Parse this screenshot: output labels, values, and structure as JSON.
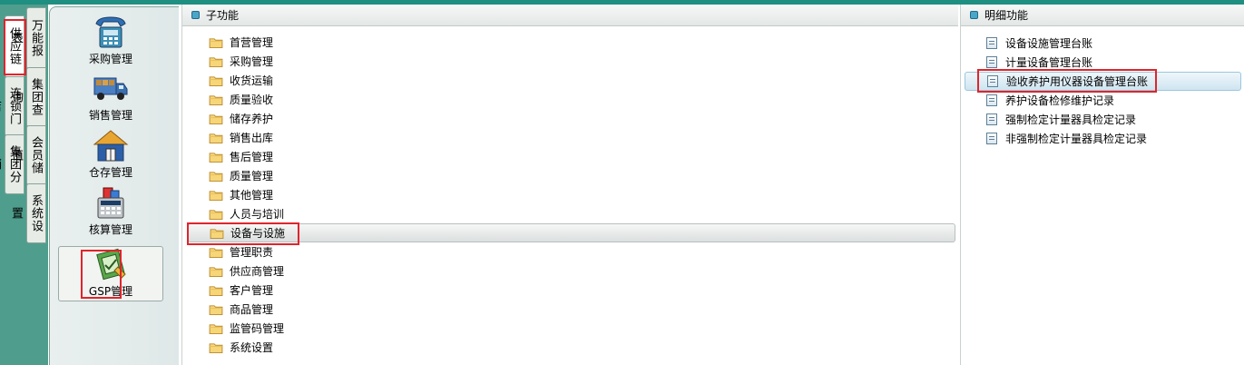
{
  "left_tabs": {
    "col1": [
      "供应链",
      "连锁门店",
      "集团分销"
    ],
    "col2": [
      "万能报表",
      "集团查询",
      "会员储值",
      "系统设置"
    ]
  },
  "modules": [
    {
      "label": "采购管理",
      "icon": "purchase-phone-icon"
    },
    {
      "label": "销售管理",
      "icon": "delivery-truck-icon"
    },
    {
      "label": "仓存管理",
      "icon": "warehouse-house-icon"
    },
    {
      "label": "核算管理",
      "icon": "accounting-calculator-icon"
    },
    {
      "label": "GSP管理",
      "icon": "gsp-certificate-icon"
    }
  ],
  "sub_panel": {
    "title": "子功能",
    "items": [
      "首营管理",
      "采购管理",
      "收货运输",
      "质量验收",
      "储存养护",
      "销售出库",
      "售后管理",
      "质量管理",
      "其他管理",
      "人员与培训",
      "设备与设施",
      "管理职责",
      "供应商管理",
      "客户管理",
      "商品管理",
      "监管码管理",
      "系统设置"
    ],
    "selected_index": 10
  },
  "detail_panel": {
    "title": "明细功能",
    "items": [
      "设备设施管理台账",
      "计量设备管理台账",
      "验收养护用仪器设备管理台账",
      "养护设备检修维护记录",
      "强制检定计量器具检定记录",
      "非强制检定计量器具检定记录"
    ],
    "selected_index": 2
  },
  "colors": {
    "accent": "#1f8f82",
    "highlight": "#e0242b"
  }
}
